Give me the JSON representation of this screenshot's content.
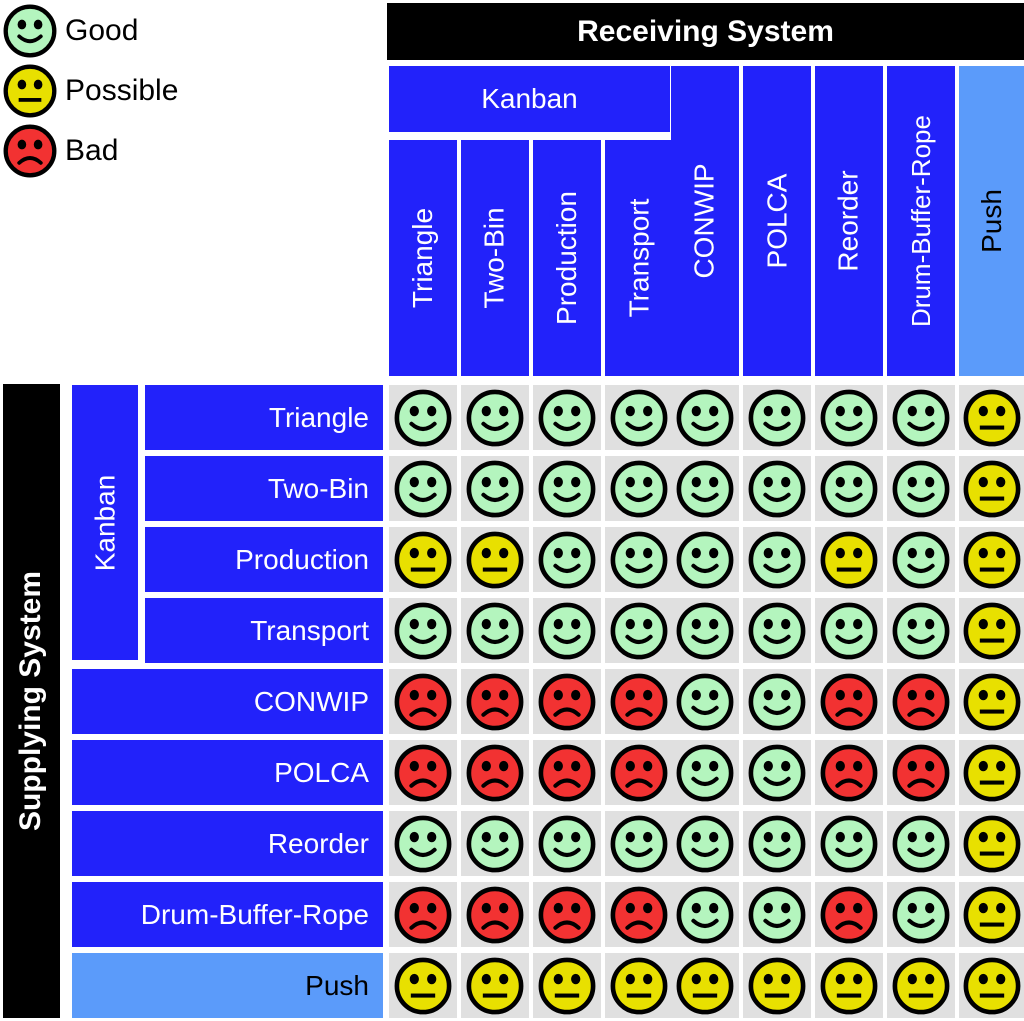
{
  "legend": {
    "items": [
      {
        "icon": "good-face-icon",
        "label": "Good",
        "color": "#B4F5BE",
        "mouth": "smile"
      },
      {
        "icon": "possible-face-icon",
        "label": "Possible",
        "color": "#E8E000",
        "mouth": "neutral"
      },
      {
        "icon": "bad-face-icon",
        "label": "Bad",
        "color": "#F23232",
        "mouth": "frown"
      }
    ]
  },
  "header": {
    "receiving_title": "Receiving System",
    "supplying_title": "Supplying System"
  },
  "columns": {
    "group_label": "Kanban",
    "items": [
      {
        "label": "Triangle",
        "style": "dark"
      },
      {
        "label": "Two-Bin",
        "style": "dark"
      },
      {
        "label": "Production",
        "style": "dark"
      },
      {
        "label": "Transport",
        "style": "dark"
      },
      {
        "label": "CONWIP",
        "style": "dark"
      },
      {
        "label": "POLCA",
        "style": "dark"
      },
      {
        "label": "Reorder",
        "style": "dark"
      },
      {
        "label": "Drum-Buffer-Rope",
        "style": "dark"
      },
      {
        "label": "Push",
        "style": "light"
      }
    ]
  },
  "rows": {
    "group_label": "Kanban",
    "items": [
      {
        "label": "Triangle",
        "style": "dark"
      },
      {
        "label": "Two-Bin",
        "style": "dark"
      },
      {
        "label": "Production",
        "style": "dark"
      },
      {
        "label": "Transport",
        "style": "dark"
      },
      {
        "label": "CONWIP",
        "style": "dark"
      },
      {
        "label": "POLCA",
        "style": "dark"
      },
      {
        "label": "Reorder",
        "style": "dark"
      },
      {
        "label": "Drum-Buffer-Rope",
        "style": "dark"
      },
      {
        "label": "Push",
        "style": "light"
      }
    ]
  },
  "colors": {
    "good": "#B4F5BE",
    "possible": "#E8E000",
    "bad": "#F23232",
    "header_black": "#000000",
    "blue_dark": "#2222FA",
    "blue_light": "#5B9BFA",
    "cell_bg": "#E0E0E0"
  },
  "chart_data": {
    "type": "heatmap",
    "title": "Receiving System vs Supplying System compatibility matrix",
    "xlabel": "Receiving System",
    "ylabel": "Supplying System",
    "categories_x": [
      "Triangle",
      "Two-Bin",
      "Production",
      "Transport",
      "CONWIP",
      "POLCA",
      "Reorder",
      "Drum-Buffer-Rope",
      "Push"
    ],
    "categories_y": [
      "Triangle",
      "Two-Bin",
      "Production",
      "Transport",
      "CONWIP",
      "POLCA",
      "Reorder",
      "Drum-Buffer-Rope",
      "Push"
    ],
    "value_scale": [
      "good",
      "possible",
      "bad"
    ],
    "legend_position": "top-left",
    "grid": true,
    "matrix": [
      [
        "good",
        "good",
        "good",
        "good",
        "good",
        "good",
        "good",
        "good",
        "possible"
      ],
      [
        "good",
        "good",
        "good",
        "good",
        "good",
        "good",
        "good",
        "good",
        "possible"
      ],
      [
        "possible",
        "possible",
        "good",
        "good",
        "good",
        "good",
        "possible",
        "good",
        "possible"
      ],
      [
        "good",
        "good",
        "good",
        "good",
        "good",
        "good",
        "good",
        "good",
        "possible"
      ],
      [
        "bad",
        "bad",
        "bad",
        "bad",
        "good",
        "good",
        "bad",
        "bad",
        "possible"
      ],
      [
        "bad",
        "bad",
        "bad",
        "bad",
        "good",
        "good",
        "bad",
        "bad",
        "possible"
      ],
      [
        "good",
        "good",
        "good",
        "good",
        "good",
        "good",
        "good",
        "good",
        "possible"
      ],
      [
        "bad",
        "bad",
        "bad",
        "bad",
        "good",
        "good",
        "bad",
        "good",
        "possible"
      ],
      [
        "possible",
        "possible",
        "possible",
        "possible",
        "possible",
        "possible",
        "possible",
        "possible",
        "possible"
      ]
    ]
  }
}
